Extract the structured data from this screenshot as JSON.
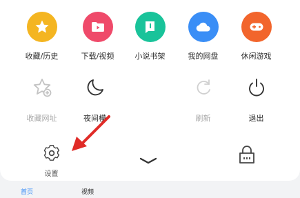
{
  "menu": {
    "row1": [
      {
        "label": "收藏/历史",
        "icon": "star-icon",
        "color": "#f4b521"
      },
      {
        "label": "下载/视频",
        "icon": "download-folder-icon",
        "color": "#ef4a6a"
      },
      {
        "label": "小说书架",
        "icon": "book-icon",
        "color": "#19c39a"
      },
      {
        "label": "我的网盘",
        "icon": "cloud-icon",
        "color": "#3a8ef6"
      },
      {
        "label": "休闲游戏",
        "icon": "gamepad-icon",
        "color": "#f2652c"
      }
    ],
    "row2": [
      {
        "label": "收藏网址",
        "icon": "add-favorite-icon",
        "state": "disabled"
      },
      {
        "label": "夜间模",
        "icon": "moon-icon",
        "state": "normal"
      },
      {
        "label": "",
        "icon": "",
        "state": "hidden"
      },
      {
        "label": "刷新",
        "icon": "refresh-icon",
        "state": "disabled"
      },
      {
        "label": "退出",
        "icon": "power-icon",
        "state": "normal"
      }
    ],
    "row3": [
      {
        "label": "设置",
        "icon": "settings-icon"
      }
    ]
  },
  "bottom_nav": {
    "items": [
      {
        "label": "首页",
        "active": true
      },
      {
        "label": "视频",
        "active": false
      }
    ]
  },
  "colors": {
    "accent": "#3a8ef6",
    "annotation_arrow": "#e02b27"
  }
}
